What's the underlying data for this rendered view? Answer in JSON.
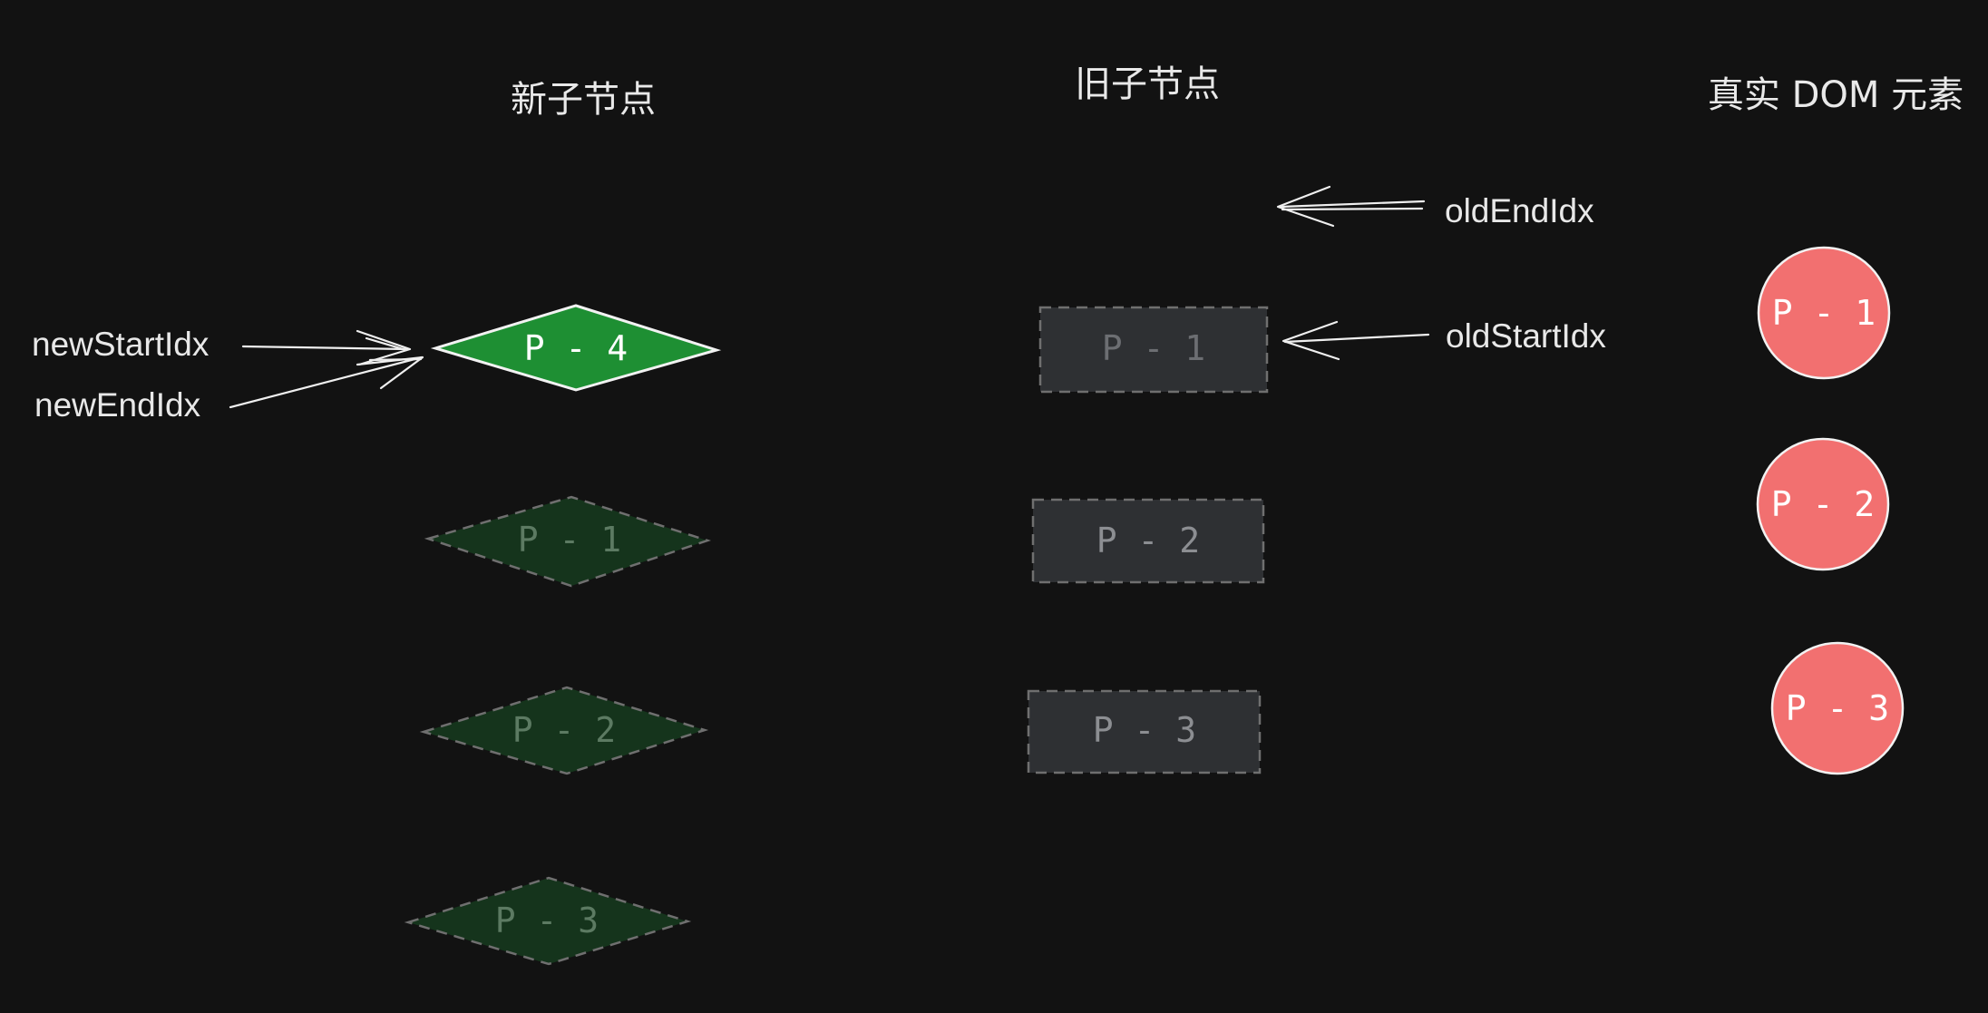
{
  "columns": {
    "new_children": "新子节点",
    "old_children": "旧子节点",
    "real_dom": "真实 DOM 元素"
  },
  "pointers": {
    "new_start": "newStartIdx",
    "new_end": "newEndIdx",
    "old_end": "oldEndIdx",
    "old_start": "oldStartIdx"
  },
  "new_nodes": [
    {
      "label": "P - 4",
      "state": "active"
    },
    {
      "label": "P - 1",
      "state": "faded"
    },
    {
      "label": "P - 2",
      "state": "faded"
    },
    {
      "label": "P - 3",
      "state": "faded"
    }
  ],
  "old_nodes": [
    {
      "label": "P - 1"
    },
    {
      "label": "P - 2"
    },
    {
      "label": "P - 3"
    }
  ],
  "dom_nodes": [
    {
      "label": "P - 1"
    },
    {
      "label": "P - 2"
    },
    {
      "label": "P - 3"
    }
  ],
  "colors": {
    "background": "#121212",
    "new_active_fill": "#1e8f33",
    "new_faded_fill": "#15341c",
    "old_fill": "#2e3033",
    "dom_fill": "#f27070",
    "stroke_light": "#efefef",
    "stroke_dashed": "#6f6f6f"
  }
}
